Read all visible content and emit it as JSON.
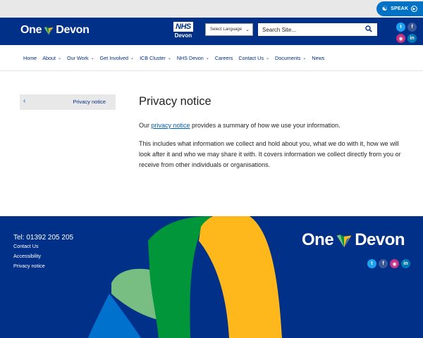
{
  "topbar": {
    "speak_label": "SPEAK"
  },
  "header": {
    "logo_left": "One",
    "logo_right": "Devon",
    "nhs_badge": "NHS",
    "nhs_sub": "Devon",
    "language_select": "Select Language",
    "search_placeholder": "Search Site...",
    "social": [
      "twitter-icon",
      "facebook-icon",
      "instagram-icon",
      "linkedin-icon"
    ]
  },
  "nav": {
    "items": [
      {
        "label": "Home",
        "dropdown": false
      },
      {
        "label": "About",
        "dropdown": true
      },
      {
        "label": "Our Work",
        "dropdown": true
      },
      {
        "label": "Get Involved",
        "dropdown": true
      },
      {
        "label": "ICB Cluster",
        "dropdown": true
      },
      {
        "label": "NHS Devon",
        "dropdown": true
      },
      {
        "label": "Careers",
        "dropdown": false
      },
      {
        "label": "Contact Us",
        "dropdown": true
      },
      {
        "label": "Documents",
        "dropdown": true
      },
      {
        "label": "News",
        "dropdown": false
      }
    ]
  },
  "sidemenu": {
    "back_glyph": "‹",
    "label": "Privacy notice"
  },
  "main": {
    "title": "Privacy notice",
    "p1_before": "Our ",
    "p1_link": "privacy notice",
    "p1_after": " provides a summary of how we use your information.",
    "p2": "This includes what information we collect and hold about you, what we do with it, how we will look after it and who we may share it with. It covers information we collect directly from you or receive from other individuals or organisations."
  },
  "footer": {
    "telephone": "Tel: 01392 205 205",
    "links": [
      "Contact Us",
      "Accessibility",
      "Privacy notice"
    ],
    "logo_left": "One",
    "logo_right": "Devon"
  },
  "colors": {
    "navy": "#003087",
    "nhs_blue": "#005eb8",
    "ribbon_yellow": "#ffb81c",
    "ribbon_green": "#009639",
    "ribbon_light_green": "#78be83",
    "ribbon_blue": "#0072ce"
  }
}
